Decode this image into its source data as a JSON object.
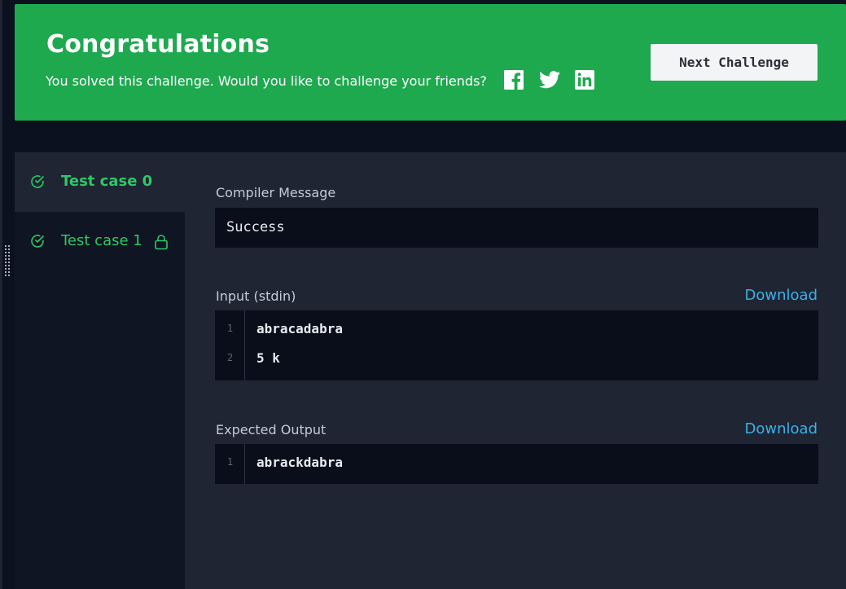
{
  "banner": {
    "title": "Congratulations",
    "subtitle": "You solved this challenge. Would you like to challenge your friends?",
    "next_button": "Next Challenge",
    "social_icons": [
      "facebook-icon",
      "twitter-icon",
      "linkedin-icon"
    ]
  },
  "test_cases": [
    {
      "label": "Test case 0",
      "status": "passed",
      "active": true,
      "locked": false
    },
    {
      "label": "Test case 1",
      "status": "passed",
      "active": false,
      "locked": true
    }
  ],
  "compiler": {
    "label": "Compiler Message",
    "message": "Success"
  },
  "input": {
    "label": "Input (stdin)",
    "download": "Download",
    "lines": [
      {
        "num": "1",
        "text": "abracadabra"
      },
      {
        "num": "2",
        "text": "5 k"
      }
    ]
  },
  "expected": {
    "label": "Expected Output",
    "download": "Download",
    "lines": [
      {
        "num": "1",
        "text": "abrackdabra"
      }
    ]
  },
  "colors": {
    "banner_green": "#1ea94f",
    "pass_green": "#2ec866",
    "link_blue": "#39b1e8",
    "panel_bg": "#1f2533"
  }
}
